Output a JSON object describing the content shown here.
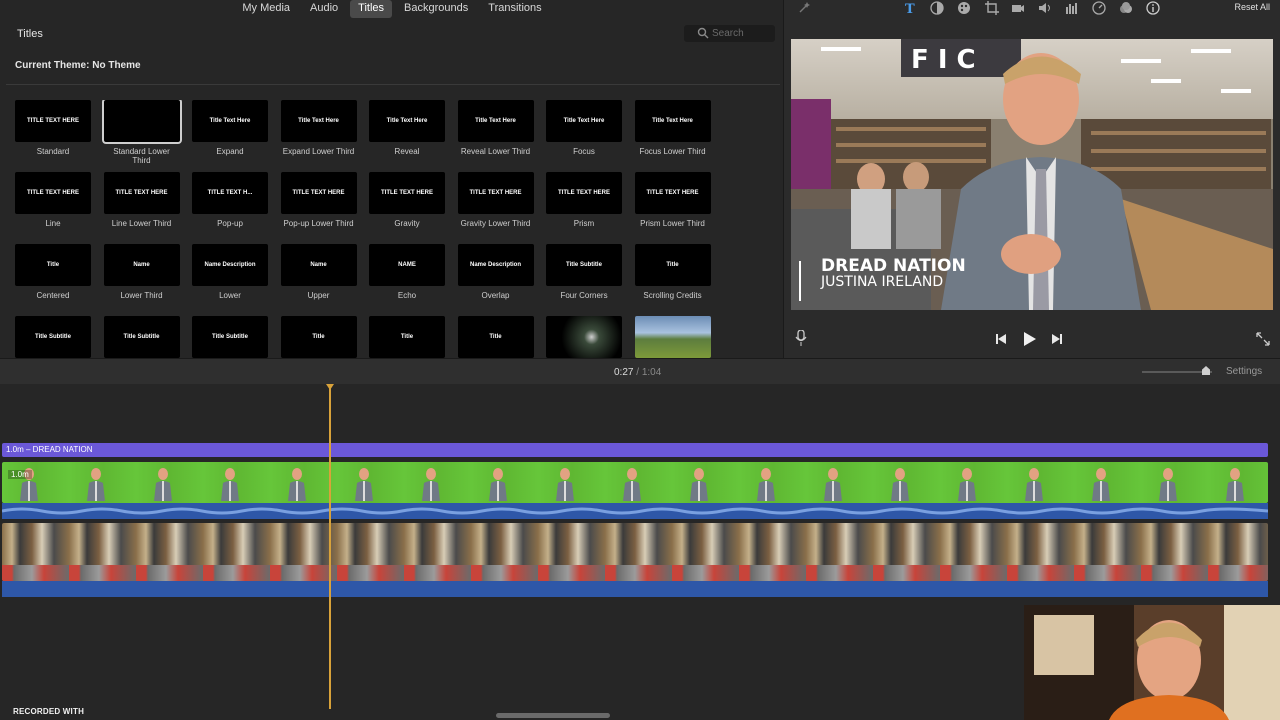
{
  "media_tabs": [
    {
      "label": "My Media",
      "active": false
    },
    {
      "label": "Audio",
      "active": false
    },
    {
      "label": "Titles",
      "active": true
    },
    {
      "label": "Backgrounds",
      "active": false
    },
    {
      "label": "Transitions",
      "active": false
    }
  ],
  "browser": {
    "title": "Titles",
    "search_placeholder": "Search",
    "theme_label": "Current Theme: No Theme"
  },
  "titles": [
    {
      "name": "Standard",
      "sample": "TITLE TEXT HERE"
    },
    {
      "name": "Standard Lower Third",
      "sample": "",
      "selected": true
    },
    {
      "name": "Expand",
      "sample": "Title Text Here"
    },
    {
      "name": "Expand Lower Third",
      "sample": "Title Text Here"
    },
    {
      "name": "Reveal",
      "sample": "Title Text Here"
    },
    {
      "name": "Reveal Lower Third",
      "sample": "Title Text Here"
    },
    {
      "name": "Focus",
      "sample": "Title Text Here"
    },
    {
      "name": "Focus Lower Third",
      "sample": "Title Text Here"
    },
    {
      "name": "Line",
      "sample": "TITLE TEXT HERE"
    },
    {
      "name": "Line Lower Third",
      "sample": "TITLE TEXT HERE"
    },
    {
      "name": "Pop-up",
      "sample": "TITLE TEXT H..."
    },
    {
      "name": "Pop-up Lower Third",
      "sample": "TITLE TEXT HERE"
    },
    {
      "name": "Gravity",
      "sample": "TITLE TEXT HERE"
    },
    {
      "name": "Gravity Lower Third",
      "sample": "TITLE TEXT HERE"
    },
    {
      "name": "Prism",
      "sample": "TITLE TEXT HERE"
    },
    {
      "name": "Prism Lower Third",
      "sample": "TITLE TEXT HERE"
    },
    {
      "name": "Centered",
      "sample": "Title"
    },
    {
      "name": "Lower Third",
      "sample": "Name"
    },
    {
      "name": "Lower",
      "sample": "Name Description"
    },
    {
      "name": "Upper",
      "sample": "Name"
    },
    {
      "name": "Echo",
      "sample": "NAME"
    },
    {
      "name": "Overlap",
      "sample": "Name Description"
    },
    {
      "name": "Four Corners",
      "sample": "Title Subtitle"
    },
    {
      "name": "Scrolling Credits",
      "sample": "Title"
    },
    {
      "name": "",
      "sample": "Title Subtitle"
    },
    {
      "name": "",
      "sample": "Title Subtitle"
    },
    {
      "name": "",
      "sample": "Title Subtitle"
    },
    {
      "name": "",
      "sample": "Title"
    },
    {
      "name": "",
      "sample": "Title"
    },
    {
      "name": "",
      "sample": "Title"
    },
    {
      "name": "",
      "sample": "",
      "style": "bokeh"
    },
    {
      "name": "",
      "sample": "",
      "style": "landscape"
    }
  ],
  "viewer": {
    "reset_all": "Reset All",
    "lower_third_title": "DREAD NATION",
    "lower_third_subtitle": "JUSTINA IRELAND",
    "sign_text": "F I C"
  },
  "timeline": {
    "current_time": "0:27",
    "separator": "/",
    "total_time": "1:04",
    "settings_label": "Settings",
    "title_clip_label": "1.0m – DREAD NATION",
    "green_clip_badge": "1.0m"
  },
  "overlay": {
    "recorded_with": "RECORDED WITH"
  },
  "colors": {
    "title_clip": "#6b58d8",
    "green_screen": "#66c63a",
    "audio": "#2e57a8",
    "playhead": "#d8a23a"
  }
}
